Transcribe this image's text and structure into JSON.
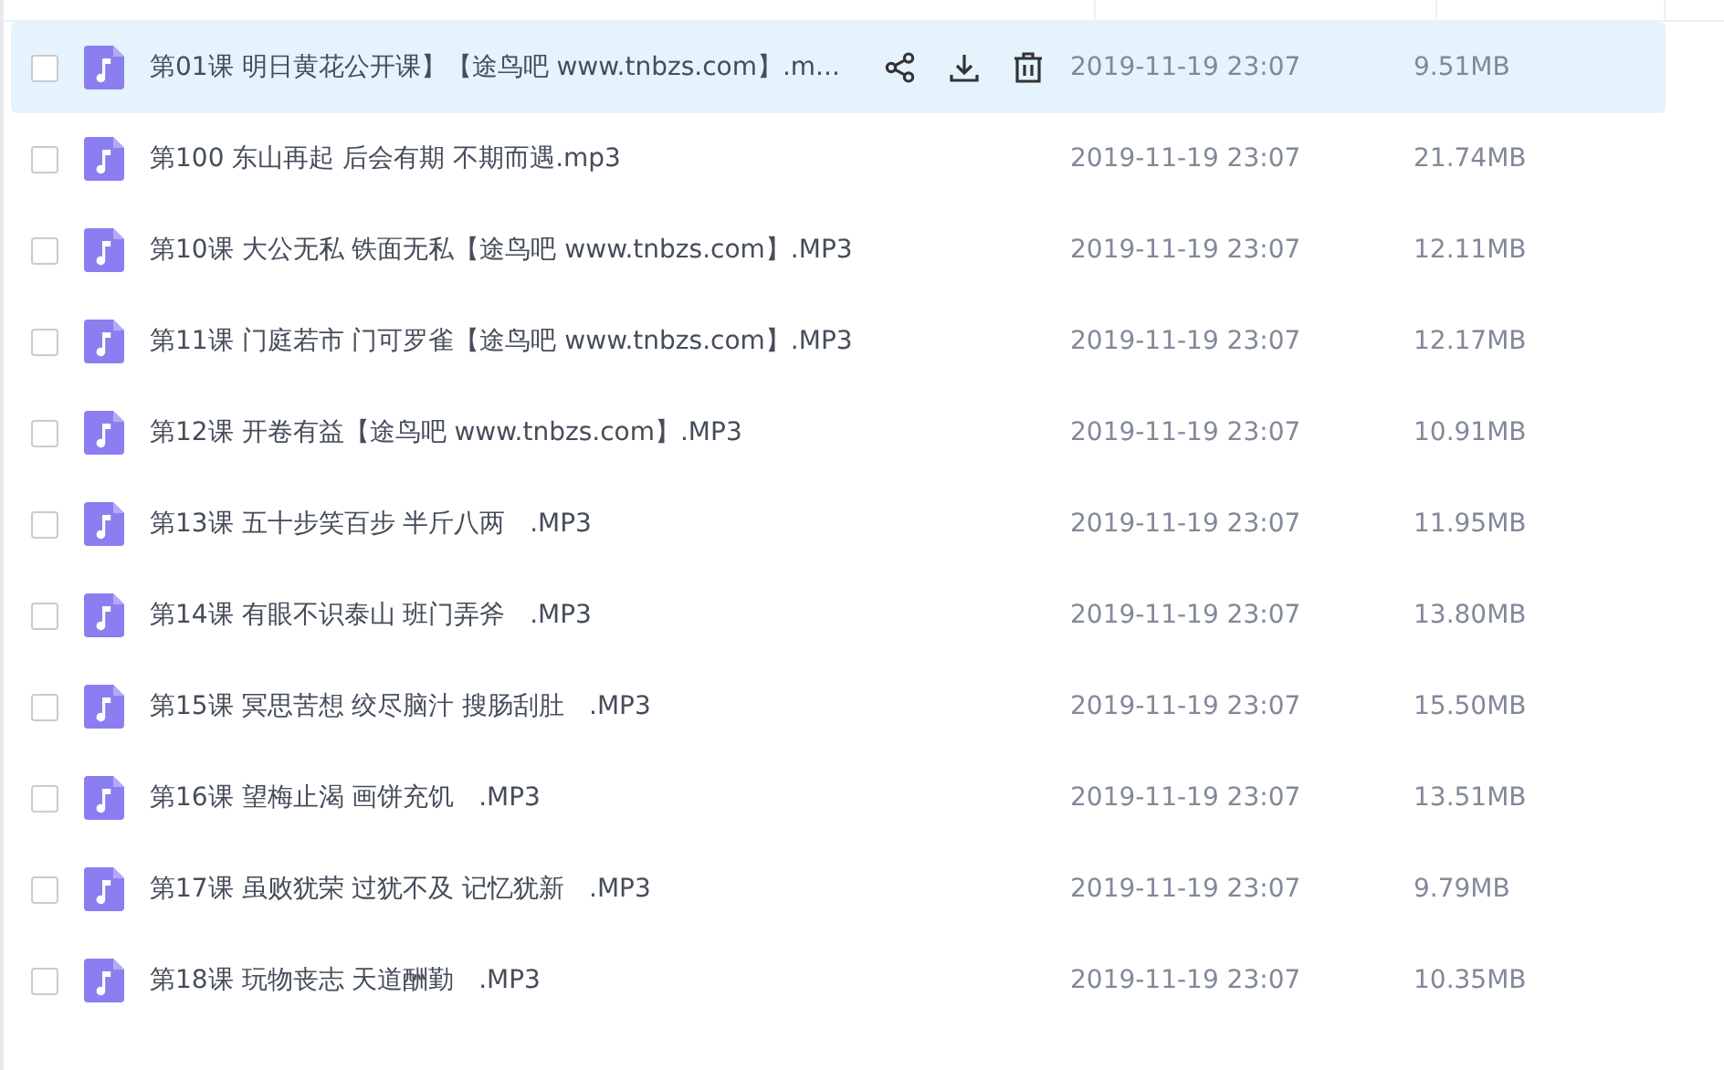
{
  "file_list": {
    "rows": [
      {
        "name": "第01课 明日黄花公开课】【途鸟吧 www.tnbzs.com】.m...",
        "modified": "2019-11-19 23:07",
        "size": "9.51MB",
        "checked": false,
        "hovered": true
      },
      {
        "name": "第100 东山再起 后会有期 不期而遇.mp3",
        "modified": "2019-11-19 23:07",
        "size": "21.74MB",
        "checked": false,
        "hovered": false
      },
      {
        "name": "第10课 大公无私 铁面无私【途鸟吧 www.tnbzs.com】.MP3",
        "modified": "2019-11-19 23:07",
        "size": "12.11MB",
        "checked": false,
        "hovered": false
      },
      {
        "name": "第11课 门庭若市 门可罗雀【途鸟吧 www.tnbzs.com】.MP3",
        "modified": "2019-11-19 23:07",
        "size": "12.17MB",
        "checked": false,
        "hovered": false
      },
      {
        "name": "第12课 开卷有益【途鸟吧 www.tnbzs.com】.MP3",
        "modified": "2019-11-19 23:07",
        "size": "10.91MB",
        "checked": false,
        "hovered": false
      },
      {
        "name": "第13课 五十步笑百步 半斤八两   .MP3",
        "modified": "2019-11-19 23:07",
        "size": "11.95MB",
        "checked": false,
        "hovered": false
      },
      {
        "name": "第14课 有眼不识泰山 班门弄斧   .MP3",
        "modified": "2019-11-19 23:07",
        "size": "13.80MB",
        "checked": false,
        "hovered": false
      },
      {
        "name": "第15课 冥思苦想 绞尽脑汁 搜肠刮肚   .MP3",
        "modified": "2019-11-19 23:07",
        "size": "15.50MB",
        "checked": false,
        "hovered": false
      },
      {
        "name": "第16课 望梅止渴 画饼充饥   .MP3",
        "modified": "2019-11-19 23:07",
        "size": "13.51MB",
        "checked": false,
        "hovered": false
      },
      {
        "name": "第17课 虽败犹荣 过犹不及 记忆犹新   .MP3",
        "modified": "2019-11-19 23:07",
        "size": "9.79MB",
        "checked": false,
        "hovered": false
      },
      {
        "name": "第18课 玩物丧志 天道酬勤   .MP3",
        "modified": "2019-11-19 23:07",
        "size": "10.35MB",
        "checked": false,
        "hovered": false
      }
    ]
  }
}
